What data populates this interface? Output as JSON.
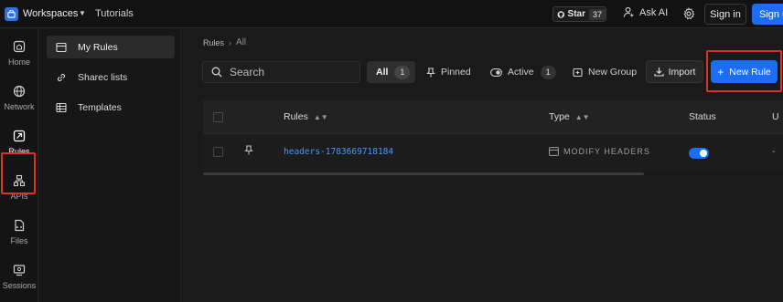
{
  "topbar": {
    "workspace_label": "Workspaces",
    "tutorials_label": "Tutorials",
    "github_star_label": "Star",
    "github_star_count": "37",
    "ask_ai_label": "Ask AI",
    "sign_in_label": "Sign in",
    "sign_up_label": "Sign up"
  },
  "rail": {
    "items": [
      {
        "label": "Home",
        "icon": "home-icon"
      },
      {
        "label": "Network",
        "icon": "network-icon"
      },
      {
        "label": "Rules",
        "icon": "rules-icon"
      },
      {
        "label": "APIs",
        "icon": "apis-icon"
      },
      {
        "label": "Files",
        "icon": "files-icon"
      },
      {
        "label": "Sessions",
        "icon": "sessions-icon"
      }
    ],
    "active": "Rules"
  },
  "sidebar": {
    "items": [
      {
        "label": "My Rules",
        "icon": "rules-list-icon"
      },
      {
        "label": "Sharec lists",
        "icon": "link-icon"
      },
      {
        "label": "Templates",
        "icon": "table-icon"
      }
    ]
  },
  "breadcrumb": {
    "root": "Rules",
    "separator": "›",
    "current": "All"
  },
  "toolbar": {
    "search_placeholder": "Search",
    "filter_all_label": "All",
    "filter_all_count": "1",
    "filter_pinned_label": "Pinned",
    "filter_active_label": "Active",
    "filter_active_count": "1",
    "new_group_label": "New Group",
    "import_label": "Import",
    "new_rule_label": "New Rule"
  },
  "table": {
    "columns": [
      "Rules",
      "Type",
      "Status",
      "U"
    ],
    "rows": [
      {
        "name": "headers-1783669718184",
        "type": "MODIFY HEADERS",
        "status_enabled": true,
        "last": "-"
      }
    ]
  },
  "colors": {
    "accent": "#1b6ef2",
    "highlight_border": "#d9342b",
    "link": "#4d96f5"
  }
}
